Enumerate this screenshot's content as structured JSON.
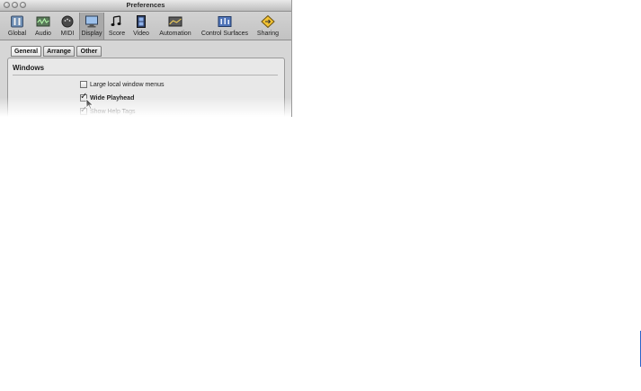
{
  "window": {
    "title": "Preferences"
  },
  "toolbar": {
    "items": [
      {
        "label": "Global",
        "icon": "global-icon"
      },
      {
        "label": "Audio",
        "icon": "audio-icon"
      },
      {
        "label": "MIDI",
        "icon": "midi-icon"
      },
      {
        "label": "Display",
        "icon": "display-icon",
        "selected": true
      },
      {
        "label": "Score",
        "icon": "score-icon"
      },
      {
        "label": "Video",
        "icon": "video-icon"
      },
      {
        "label": "Automation",
        "icon": "automation-icon"
      },
      {
        "label": "Control Surfaces",
        "icon": "control-surfaces-icon"
      },
      {
        "label": "Sharing",
        "icon": "sharing-icon"
      }
    ]
  },
  "tabs": [
    {
      "label": "General",
      "active": true
    },
    {
      "label": "Arrange"
    },
    {
      "label": "Other"
    }
  ],
  "windows_section": {
    "heading": "Windows",
    "options": [
      {
        "label": "Large local window menus",
        "checked": false
      },
      {
        "label": "Wide Playhead",
        "checked": true
      },
      {
        "label": "Show Help Tags",
        "checked": true
      }
    ]
  },
  "colors": {
    "accent_rule": "#2c63c8",
    "selected_tool": "#a9a9a9"
  }
}
